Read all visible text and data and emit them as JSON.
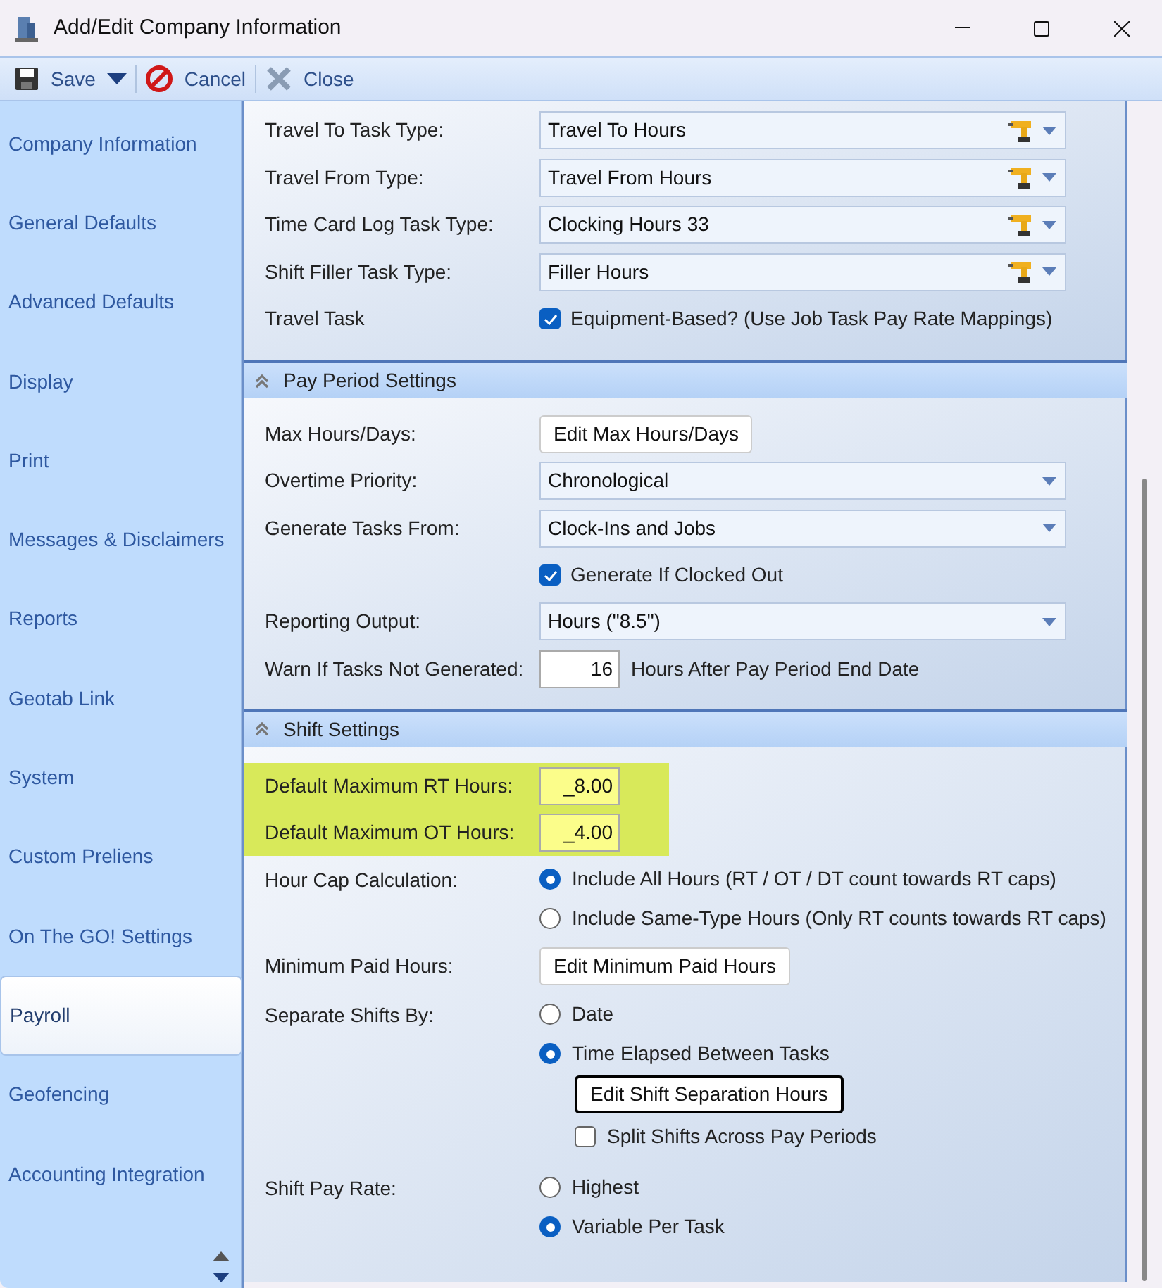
{
  "window": {
    "title": "Add/Edit Company Information"
  },
  "toolbar": [
    {
      "kind": "save",
      "label": "Save",
      "has_menu": true
    },
    {
      "kind": "cancel",
      "label": "Cancel",
      "has_menu": false
    },
    {
      "kind": "close",
      "label": "Close",
      "has_menu": false
    }
  ],
  "sidebar": {
    "items": [
      {
        "label": "Company Information",
        "selected": false
      },
      {
        "label": "General Defaults",
        "selected": false
      },
      {
        "label": "Advanced Defaults",
        "selected": false
      },
      {
        "label": "Display",
        "selected": false
      },
      {
        "label": "Print",
        "selected": false
      },
      {
        "label": "Messages & Disclaimers",
        "selected": false
      },
      {
        "label": "Reports",
        "selected": false
      },
      {
        "label": "Geotab Link",
        "selected": false
      },
      {
        "label": "System",
        "selected": false
      },
      {
        "label": "Custom Preliens",
        "selected": false
      },
      {
        "label": "On The GO! Settings",
        "selected": false
      },
      {
        "label": "Payroll",
        "selected": true
      },
      {
        "label": "Geofencing",
        "selected": false
      },
      {
        "label": "Accounting Integration",
        "selected": false
      }
    ]
  },
  "sections": [
    {
      "rows": [
        {
          "kind": "task_dropdown",
          "label": "Travel To Task Type:",
          "value": "Travel To Hours"
        },
        {
          "kind": "task_dropdown",
          "label": "Travel From Type:",
          "value": "Travel From Hours"
        },
        {
          "kind": "task_dropdown",
          "label": "Time Card Log Task Type:",
          "value": "Clocking Hours 33"
        },
        {
          "kind": "task_dropdown",
          "label": "Shift Filler Task Type:",
          "value": "Filler Hours"
        },
        {
          "kind": "checkbox",
          "label": "Travel Task",
          "text": "Equipment-Based? (Use Job Task Pay Rate Mappings)",
          "checked": true
        }
      ]
    },
    {
      "title": "Pay Period Settings",
      "rows": [
        {
          "kind": "button",
          "label": "Max Hours/Days:",
          "button": "Edit Max Hours/Days",
          "focused": false
        },
        {
          "kind": "dropdown",
          "label": "Overtime Priority:",
          "value": "Chronological"
        },
        {
          "kind": "dropdown",
          "label": "Generate Tasks From:",
          "value": "Clock-Ins and Jobs"
        },
        {
          "kind": "checkbox",
          "text": "Generate If Clocked Out",
          "checked": true
        },
        {
          "kind": "dropdown",
          "label": "Reporting Output:",
          "value": "Hours (\"8.5\")"
        },
        {
          "kind": "number",
          "label": "Warn If Tasks Not Generated:",
          "value": "16",
          "suffix": "Hours After Pay Period End Date",
          "highlighted": false
        }
      ]
    },
    {
      "title": "Shift Settings",
      "rows": [
        {
          "kind": "number",
          "label": "Default Maximum RT Hours:",
          "value": "_8.00",
          "highlighted": true
        },
        {
          "kind": "number",
          "label": "Default Maximum OT Hours:",
          "value": "_4.00",
          "highlighted": true
        },
        {
          "kind": "radio",
          "label": "Hour Cap Calculation:",
          "options": [
            {
              "text": "Include All Hours (RT / OT / DT count towards RT caps)",
              "selected": true
            },
            {
              "text": "Include Same-Type Hours (Only RT counts towards RT caps)",
              "selected": false
            }
          ]
        },
        {
          "kind": "button",
          "label": "Minimum Paid Hours:",
          "button": "Edit Minimum Paid Hours",
          "focused": false
        },
        {
          "kind": "radio",
          "label": "Separate Shifts By:",
          "options": [
            {
              "text": "Date",
              "selected": false
            },
            {
              "text": "Time Elapsed Between Tasks",
              "selected": true,
              "button": "Edit Shift Separation Hours",
              "button_focused": true,
              "checkbox": {
                "text": "Split Shifts Across Pay Periods",
                "checked": false
              }
            }
          ]
        },
        {
          "kind": "radio",
          "label": "Shift Pay Rate:",
          "options": [
            {
              "text": "Highest",
              "selected": false
            },
            {
              "text": "Variable Per Task",
              "selected": true
            }
          ]
        }
      ]
    }
  ]
}
